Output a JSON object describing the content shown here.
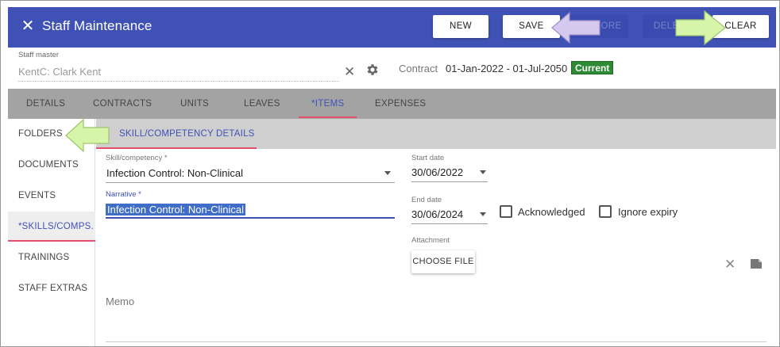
{
  "window": {
    "title": "Staff Maintenance",
    "close_icon": "close-icon"
  },
  "toolbar": {
    "new_label": "NEW",
    "save_label": "SAVE",
    "restore_label": "RESTORE",
    "delete_label": "DELETE",
    "clear_label": "CLEAR"
  },
  "staff_master": {
    "label": "Staff master",
    "value": "KentC: Clark Kent",
    "clear_icon": "close-icon",
    "settings_icon": "gear-icon",
    "contract_label": "Contract",
    "contract_value": "01-Jan-2022 - 01-Jul-2050",
    "status": "Current",
    "status_color": "#2e8a35"
  },
  "tabs": [
    {
      "label": "DETAILS",
      "active": false
    },
    {
      "label": "CONTRACTS",
      "active": false
    },
    {
      "label": "UNITS",
      "active": false
    },
    {
      "label": "LEAVES",
      "active": false
    },
    {
      "label": "*ITEMS",
      "active": true
    },
    {
      "label": "EXPENSES",
      "active": false
    }
  ],
  "sidenav": [
    {
      "label": "FOLDERS",
      "active": false
    },
    {
      "label": "DOCUMENTS",
      "active": false
    },
    {
      "label": "EVENTS",
      "active": false
    },
    {
      "label": "*SKILLS/COMPS.",
      "active": true
    },
    {
      "label": "TRAININGS",
      "active": false
    },
    {
      "label": "STAFF EXTRAS",
      "active": false
    }
  ],
  "subtab": {
    "label": "SKILL/COMPETENCY DETAILS"
  },
  "form": {
    "skill_label": "Skill/competency *",
    "skill_value": "Infection Control: Non-Clinical",
    "narrative_label": "Narrative *",
    "narrative_value": "Infection Control: Non-Clinical",
    "start_label": "Start date",
    "start_value": "30/06/2022",
    "end_label": "End date",
    "end_value": "30/06/2024",
    "acknowledged_label": "Acknowledged",
    "acknowledged_checked": false,
    "ignore_expiry_label": "Ignore expiry",
    "ignore_expiry_checked": false,
    "attachment_label": "Attachment",
    "choose_file_label": "CHOOSE FILE",
    "memo_label": "Memo"
  },
  "colors": {
    "header": "#3f51b5",
    "accent": "#3f51b5",
    "tab_indicator": "#e84e6e",
    "tab_bar": "#a3a3a3",
    "arrow_green": "#d6f5a8",
    "arrow_purple": "#d6c9f0"
  },
  "annotations": [
    {
      "icon": "arrow-left-icon",
      "color": "purple",
      "target": "save-button"
    },
    {
      "icon": "arrow-right-icon",
      "color": "green",
      "target": "clear-button"
    },
    {
      "icon": "arrow-left-icon",
      "color": "green",
      "target": "sidenav-folders"
    }
  ]
}
